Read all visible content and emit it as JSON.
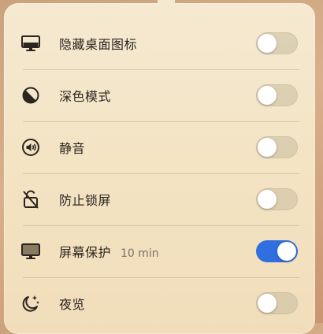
{
  "colors": {
    "toggle_on": "#2f6fe0",
    "toggle_off": "#d6ccb0",
    "panel": "#f4e6c9"
  },
  "settings": [
    {
      "icon": "monitor-icon",
      "label": "隐藏桌面图标",
      "sub": "",
      "on": false
    },
    {
      "icon": "dark-mode-icon",
      "label": "深色模式",
      "sub": "",
      "on": false
    },
    {
      "icon": "speaker-icon",
      "label": "静音",
      "sub": "",
      "on": false
    },
    {
      "icon": "lock-off-icon",
      "label": "防止锁屏",
      "sub": "",
      "on": false
    },
    {
      "icon": "screensaver-icon",
      "label": "屏幕保护",
      "sub": "10 min",
      "on": true
    },
    {
      "icon": "night-mode-icon",
      "label": "夜览",
      "sub": "",
      "on": false
    }
  ]
}
